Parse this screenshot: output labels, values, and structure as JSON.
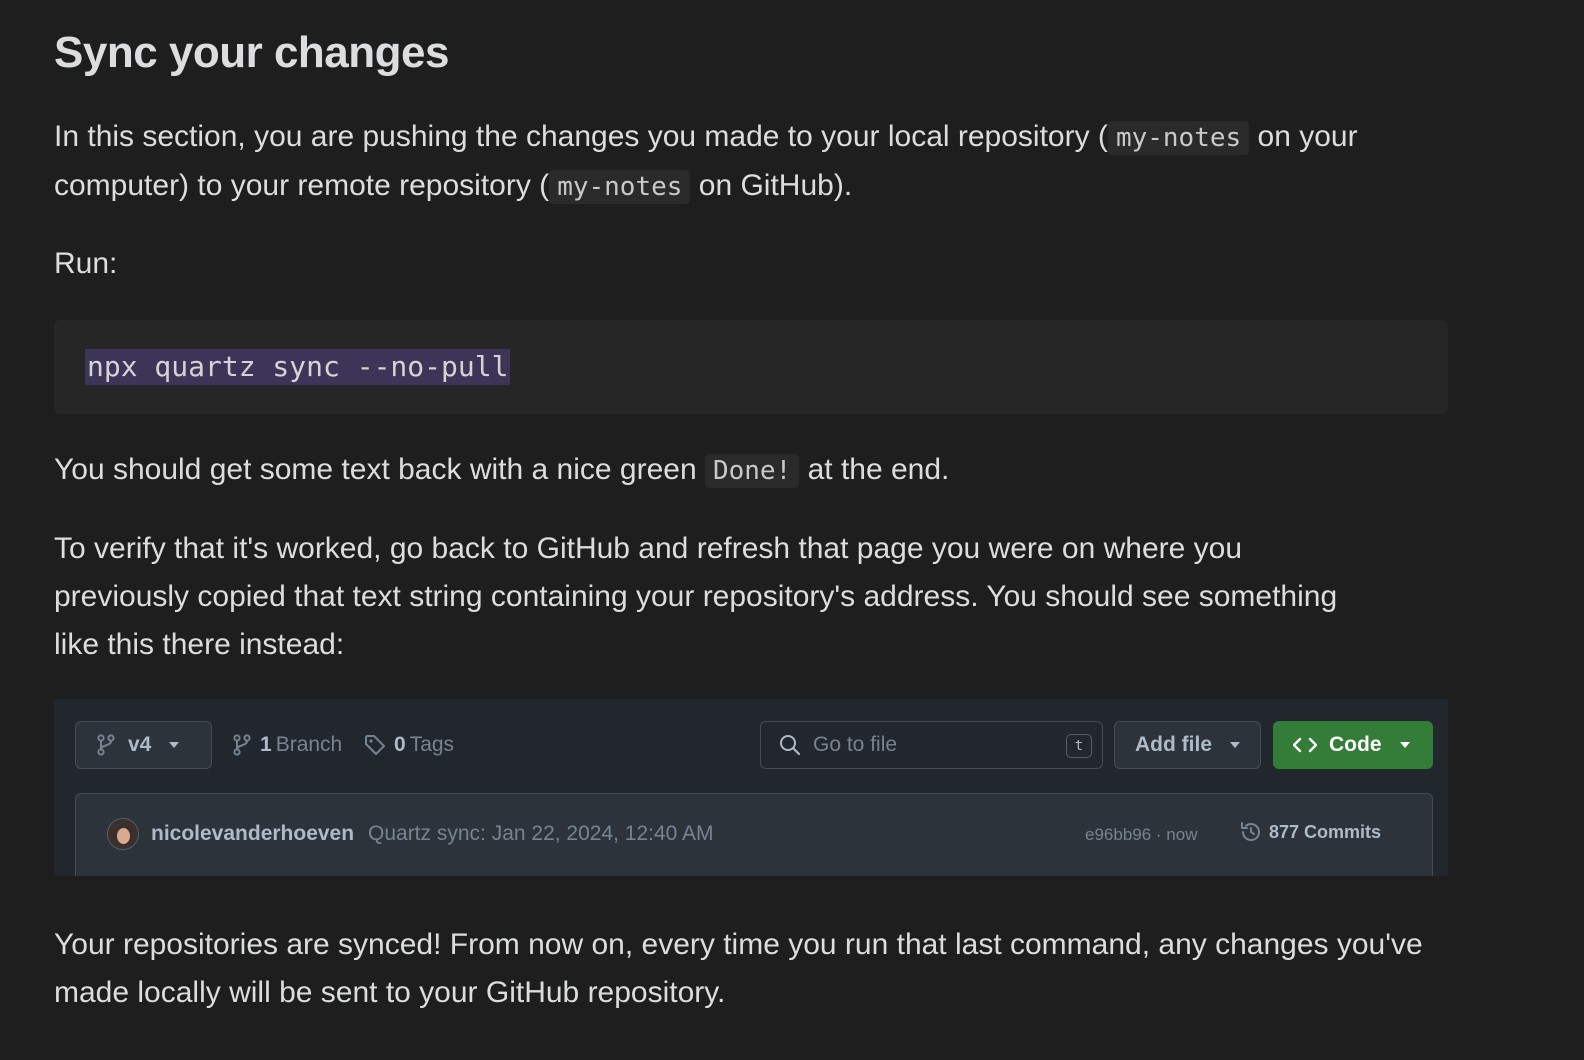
{
  "doc": {
    "title": "Sync your changes",
    "intro": {
      "t1": "In this section, you are pushing the changes you made to your local repository (",
      "c1": "my-notes",
      "t2": " on your computer) to your remote repository (",
      "c2": "my-notes",
      "t3": " on GitHub)."
    },
    "run_label": "Run:",
    "command": "npx quartz sync --no-pull",
    "done_para": {
      "t1": "You should get some text back with a nice green ",
      "c1": "Done!",
      "t2": " at the end."
    },
    "verify_para": "To verify that it's worked, go back to GitHub and refresh that page you were on where you previously copied that text string containing your repository's address. You should see something like this there instead:",
    "final_para": "Your repositories are synced! From now on, every time you run that last command, any changes you've made locally will be sent to your GitHub repository."
  },
  "github": {
    "branch_name": "v4",
    "branch_count": "1",
    "branch_label": "Branch",
    "tag_count": "0",
    "tag_label": "Tags",
    "search_placeholder": "Go to file",
    "search_shortcut": "t",
    "add_file_label": "Add file",
    "code_label": "Code",
    "author": "nicolevanderhoeven",
    "commit_message": "Quartz sync: Jan 22, 2024, 12:40 AM",
    "commit_sha_time": "e96bb96 · now",
    "commits_label": "877 Commits",
    "colors": {
      "background": "#22272e",
      "code_button": "#347d39"
    }
  }
}
